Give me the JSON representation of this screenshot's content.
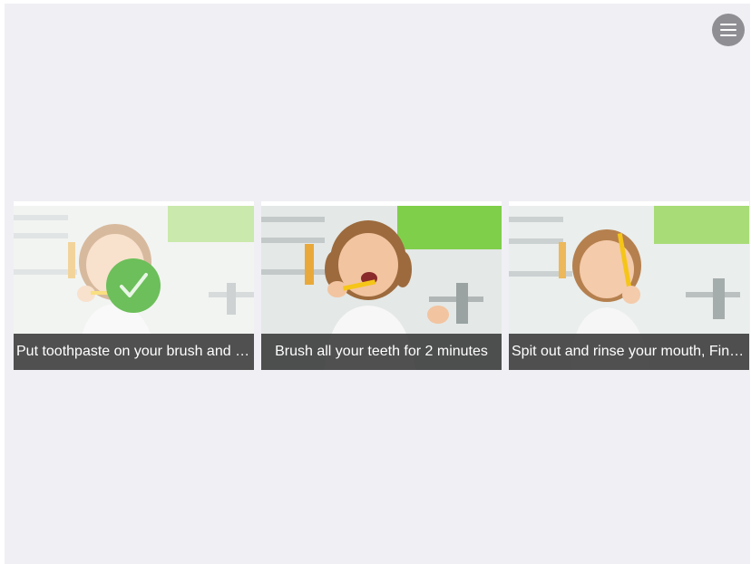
{
  "colors": {
    "background": "#efeff4",
    "menu_button": "#8e8e93",
    "caption_bg": "#333333",
    "check_badge": "#6cbf5a",
    "toothbrush": "#f5c518"
  },
  "menu": {
    "icon": "hamburger-menu-icon"
  },
  "steps": [
    {
      "caption": "Put toothpaste on your brush and put it in your mouth",
      "completed": true,
      "icon": "checkmark-icon"
    },
    {
      "caption": "Brush all your teeth for 2 minutes",
      "completed": false
    },
    {
      "caption": "Spit out and rinse your mouth, Finished brushing",
      "completed": false
    }
  ]
}
